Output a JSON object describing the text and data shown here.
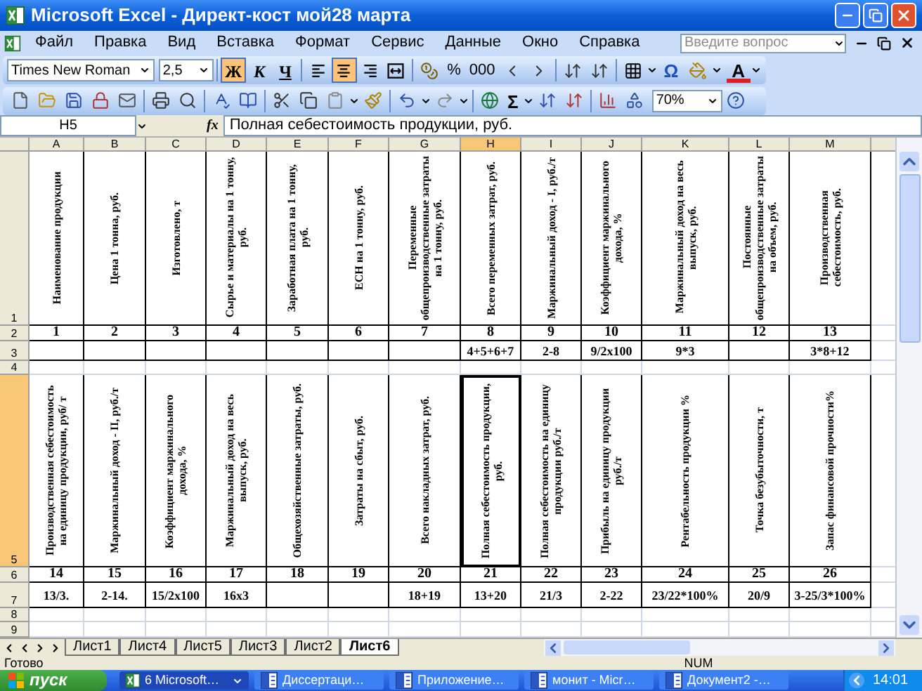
{
  "window": {
    "title": "Microsoft Excel - Директ-кост мой28 марта"
  },
  "menu": {
    "items": [
      "Файл",
      "Правка",
      "Вид",
      "Вставка",
      "Формат",
      "Сервис",
      "Данные",
      "Окно",
      "Справка"
    ],
    "help_box": {
      "placeholder": "Введите вопрос"
    }
  },
  "formatting_toolbar": {
    "font": "Times New Roman",
    "size": "2,5",
    "style_buttons": [
      {
        "label": "Ж",
        "kind": "bold",
        "pressed": true
      },
      {
        "label": "К",
        "kind": "italic",
        "pressed": false
      },
      {
        "label": "Ч",
        "kind": "underline",
        "pressed": false
      }
    ],
    "align_buttons": [
      {
        "kind": "left",
        "pressed": false
      },
      {
        "kind": "center",
        "pressed": true
      },
      {
        "kind": "right",
        "pressed": false
      },
      {
        "kind": "merge",
        "pressed": false
      }
    ],
    "number_buttons": [
      "%",
      "000"
    ],
    "symbol_button": "Ω",
    "font_color_button": "A"
  },
  "standard_toolbar": {
    "sum_button": "Σ",
    "zoom": "70%"
  },
  "formula_bar": {
    "name_box": "H5",
    "function_label": "fx",
    "formula": "Полная себестоимость продукции, руб."
  },
  "sheet": {
    "columns": [
      {
        "label": "A",
        "selected": false
      },
      {
        "label": "B",
        "selected": false
      },
      {
        "label": "C",
        "selected": false
      },
      {
        "label": "D",
        "selected": false
      },
      {
        "label": "E",
        "selected": false
      },
      {
        "label": "F",
        "selected": false
      },
      {
        "label": "G",
        "selected": false
      },
      {
        "label": "H",
        "selected": true
      },
      {
        "label": "I",
        "selected": false
      },
      {
        "label": "J",
        "selected": false
      },
      {
        "label": "K",
        "selected": false
      },
      {
        "label": "L",
        "selected": false
      },
      {
        "label": "M",
        "selected": false
      }
    ],
    "rows": [
      {
        "label": "1",
        "selected": false,
        "kind": "vertical",
        "cells": [
          "Наименование продукции",
          "Цена 1 тонна, руб.",
          "Изготовлено, т",
          "Сырье и материалы на 1 тонну, руб.",
          "Заработная плата на 1 тонну, руб.",
          "ЕСН на 1 тонну, руб.",
          "Переменные общепроизводственные затраты на 1 тонну, руб.",
          "Всего переменных затрат, руб.",
          "Маржинальный доход - I, руб./т",
          "Коэффициент маржинального дохода, %",
          "Маржинальный доход на весь выпуск, руб.",
          "Постоянные общепроизводственные затраты на объем, руб.",
          "Производственная себестоимость, руб."
        ]
      },
      {
        "label": "2",
        "selected": false,
        "kind": "number",
        "cells": [
          "1",
          "2",
          "3",
          "4",
          "5",
          "6",
          "7",
          "8",
          "9",
          "10",
          "11",
          "12",
          "13"
        ]
      },
      {
        "label": "3",
        "selected": false,
        "kind": "formula",
        "cells": [
          null,
          null,
          null,
          null,
          null,
          null,
          null,
          "4+5+6+7",
          "2-8",
          "9/2x100",
          "9*3",
          null,
          "3*8+12"
        ]
      },
      {
        "label": "4",
        "selected": false,
        "kind": "empty"
      },
      {
        "label": "5",
        "selected": true,
        "kind": "vertical",
        "cells": [
          "Производственная себестоимость на единицу продукции, руб/ т",
          "Маржинальный доход - II, руб./т",
          "Коэффициент маржинального дохода, %",
          "Маржинальный доход на весь выпуск, руб.",
          "Общехозяйственные затраты, руб.",
          "Затраты на сбыт, руб.",
          "Всего накладных затрат, руб.",
          "Полная себестоимость продукции, руб.",
          "Полная себестоимость на единицу продукции руб./т",
          "Прибыль на единицу продукции руб./т",
          "Рентабельность продукции %",
          "Точка безубыточности, т",
          "Запас финансовой прочности%"
        ]
      },
      {
        "label": "6",
        "selected": false,
        "kind": "number",
        "cells": [
          "14",
          "15",
          "16",
          "17",
          "18",
          "19",
          "20",
          "21",
          "22",
          "23",
          "24",
          "25",
          "26"
        ]
      },
      {
        "label": "7",
        "selected": false,
        "kind": "formula",
        "cells": [
          "13/3.",
          "2-14.",
          "15/2x100",
          "16x3",
          null,
          null,
          "18+19",
          "13+20",
          "21/3",
          "2-22",
          "23/22*100%",
          "20/9",
          "3-25/3*100%"
        ]
      },
      {
        "label": "8",
        "selected": false,
        "kind": "empty"
      },
      {
        "label": "9",
        "selected": false,
        "kind": "empty"
      }
    ]
  },
  "sheet_tabs": [
    {
      "label": "Лист1",
      "selected": false
    },
    {
      "label": "Лист4",
      "selected": false
    },
    {
      "label": "Лист5",
      "selected": false
    },
    {
      "label": "Лист3",
      "selected": false
    },
    {
      "label": "Лист2",
      "selected": false
    },
    {
      "label": "Лист6",
      "selected": true
    }
  ],
  "status_bar": {
    "status": "Готово",
    "num_lock": "NUM"
  },
  "taskbar": {
    "start": "пуск",
    "tasks": [
      {
        "label": "6 Microsoft…",
        "kind": "excel",
        "selected": true
      },
      {
        "label": "Диссертаци…",
        "kind": "word",
        "selected": false
      },
      {
        "label": "Приложение…",
        "kind": "word",
        "selected": false
      },
      {
        "label": "монит - Micr…",
        "kind": "word",
        "selected": false
      },
      {
        "label": "Документ2 -…",
        "kind": "word",
        "selected": false
      }
    ],
    "clock": "14:01"
  }
}
